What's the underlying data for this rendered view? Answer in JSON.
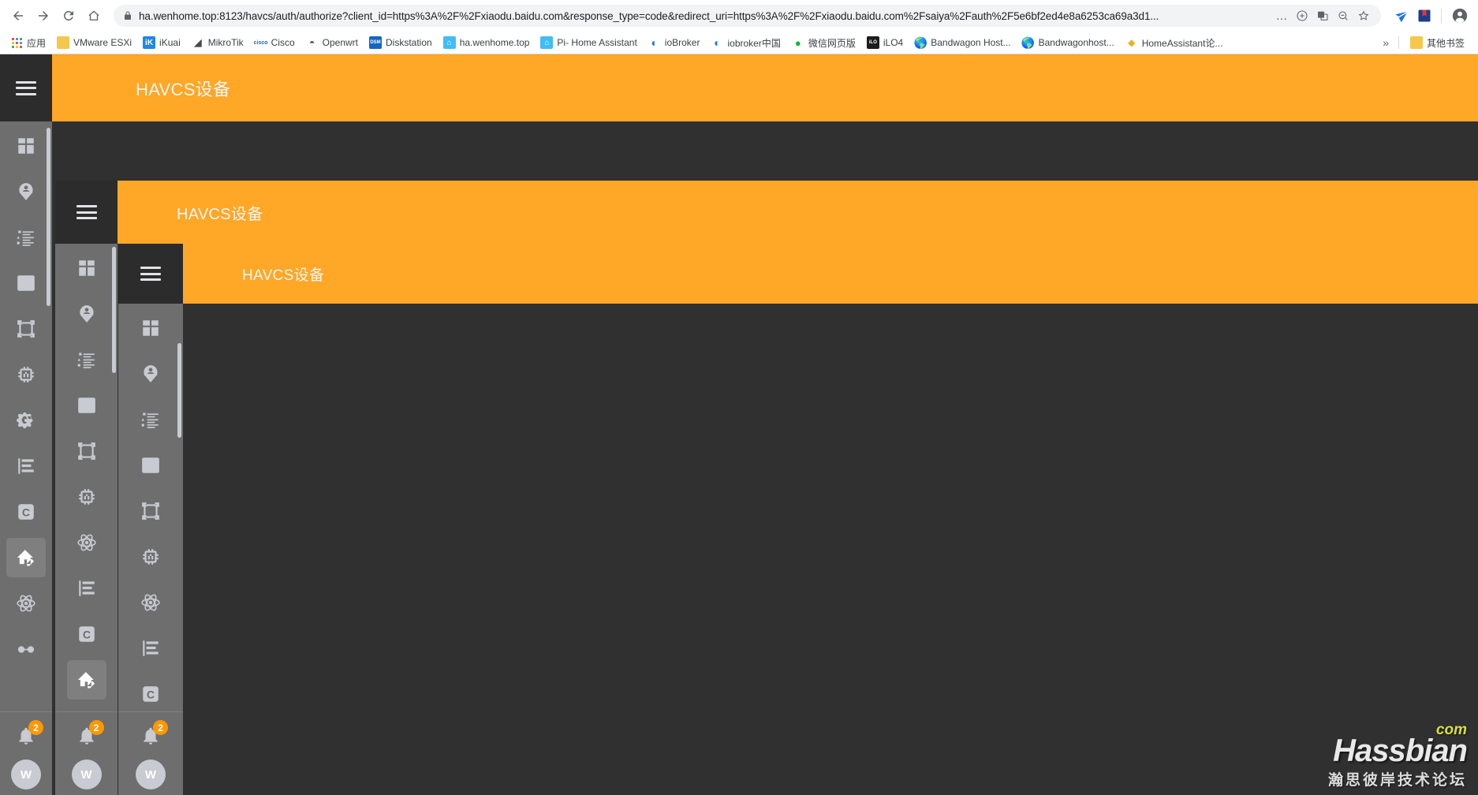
{
  "browser": {
    "back_icon": "back-arrow-icon",
    "forward_icon": "forward-arrow-icon",
    "reload_icon": "reload-icon",
    "home_icon": "home-icon",
    "url": "ha.wenhome.top:8123/havcs/auth/authorize?client_id=https%3A%2F%2Fxiaodu.baidu.com&response_type=code&redirect_uri=https%3A%2F%2Fxiaodu.baidu.com%2Fsaiya%2Fauth%2F5e6bf2ed4e8a6253ca69a3d1...",
    "lock_icon": "lock-icon",
    "omnibox_actions": [
      {
        "name": "more-actions-icon",
        "glyph": "…"
      },
      {
        "name": "add-page-icon",
        "glyph": "⊕"
      },
      {
        "name": "translate-icon",
        "glyph": "文"
      },
      {
        "name": "zoom-out-icon",
        "glyph": "⊖"
      },
      {
        "name": "bookmark-star-icon",
        "glyph": "☆"
      }
    ],
    "extensions": [
      {
        "name": "extension-blue-icon",
        "color": "#1a73e8"
      },
      {
        "name": "extension-red-book-icon",
        "color": "#d93025"
      }
    ],
    "profile_icon": "profile-avatar-icon"
  },
  "bookmarks": {
    "apps_label": "应用",
    "items": [
      {
        "label": "VMware ESXi",
        "icon_color": "#f2c94c",
        "icon_text": "V"
      },
      {
        "label": "iKuai",
        "icon_color": "#1e88e5",
        "icon_text": "iK"
      },
      {
        "label": "MikroTik",
        "icon_color": "#6e6e6e",
        "icon_text": "M"
      },
      {
        "label": "Cisco",
        "icon_color": "#2b7bb9",
        "icon_text": "c"
      },
      {
        "label": "Openwrt",
        "icon_color": "#4d4d4d",
        "icon_text": "O"
      },
      {
        "label": "Diskstation",
        "icon_color": "#1565c0",
        "icon_text": "DSM"
      },
      {
        "label": "ha.wenhome.top",
        "icon_color": "#41bdf5",
        "icon_text": "H"
      },
      {
        "label": "Pi- Home Assistant",
        "icon_color": "#41bdf5",
        "icon_text": "H"
      },
      {
        "label": "ioBroker",
        "icon_color": "#1a73e8",
        "icon_text": "()"
      },
      {
        "label": "iobroker中国",
        "icon_color": "#1a73e8",
        "icon_text": "()"
      },
      {
        "label": "微信网页版",
        "icon_color": "#09b83e",
        "icon_text": "●"
      },
      {
        "label": "iLO4",
        "icon_color": "#1c1c1c",
        "icon_text": "iLO"
      },
      {
        "label": "Bandwagon Host...",
        "icon_color": "#6e7b84",
        "icon_text": "⊕"
      },
      {
        "label": "Bandwagonhost...",
        "icon_color": "#6e7b84",
        "icon_text": "⊕"
      },
      {
        "label": "HomeAssistant论...",
        "icon_color": "#e8b320",
        "icon_text": "◆"
      }
    ],
    "overflow_glyph": "»",
    "other_label": "其他书签",
    "other_icon_color": "#f5c84c"
  },
  "app": {
    "background_color": "#303030",
    "accent_color": "#ffa726",
    "sidebar_color": "#6e6e6e",
    "sidebar_header_color": "#2c2c2c",
    "windows": [
      {
        "id": "win1",
        "title": "HAVCS设备",
        "menu_icon": "hamburger-menu-icon",
        "notification_count": "2",
        "avatar_initial": "W"
      },
      {
        "id": "win2",
        "title": "HAVCS设备",
        "menu_icon": "hamburger-menu-icon",
        "notification_count": "2",
        "avatar_initial": "W"
      },
      {
        "id": "win3",
        "title": "HAVCS设备",
        "menu_icon": "hamburger-menu-icon",
        "notification_count": "2",
        "avatar_initial": "W"
      }
    ],
    "sidebar_items": [
      {
        "name": "sidebar-item-overview",
        "icon": "view-dashboard-icon"
      },
      {
        "name": "sidebar-item-map",
        "icon": "map-marker-account-icon"
      },
      {
        "name": "sidebar-item-logbook",
        "icon": "format-list-bulleted-type-icon"
      },
      {
        "name": "sidebar-item-history",
        "icon": "chart-box-icon"
      },
      {
        "name": "sidebar-item-vector",
        "icon": "vector-square-icon"
      },
      {
        "name": "sidebar-item-memory",
        "icon": "memory-icon"
      },
      {
        "name": "sidebar-item-atom",
        "icon": "atom-icon"
      },
      {
        "name": "sidebar-item-file-tree",
        "icon": "file-tree-icon"
      },
      {
        "name": "sidebar-item-c-panel",
        "icon": "letter-c-box-icon"
      },
      {
        "name": "sidebar-item-havcs",
        "icon": "home-edit-icon",
        "selected": true
      },
      {
        "name": "sidebar-item-atom-2",
        "icon": "atom-icon"
      },
      {
        "name": "sidebar-item-glasses",
        "icon": "glasses-icon"
      }
    ],
    "bell_icon": "notification-bell-icon"
  },
  "watermark": {
    "brand": "Hassbian",
    "tld": "com",
    "subtitle": "瀚思彼岸技术论坛"
  }
}
